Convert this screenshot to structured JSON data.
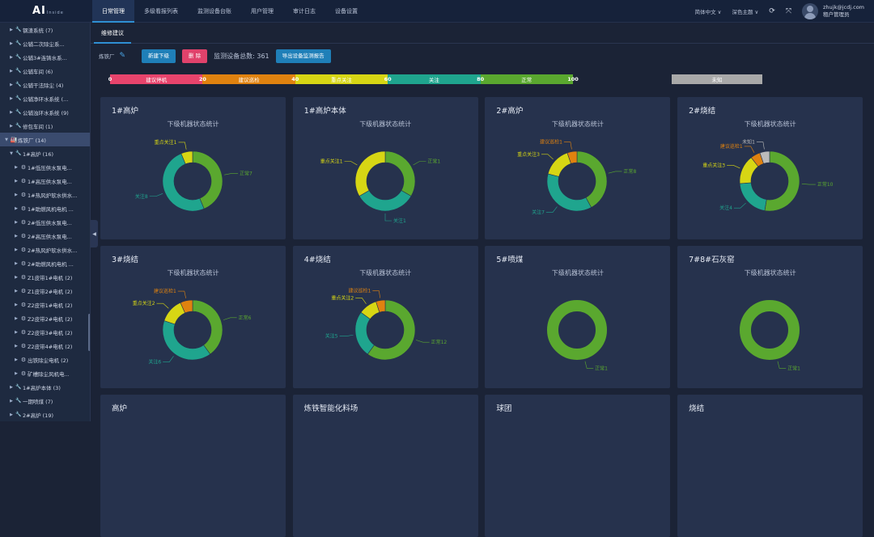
{
  "app": {
    "logo": "AI",
    "logo_small": "Inside"
  },
  "nav": [
    "日常管理",
    "多级看报列表",
    "监测设备台账",
    "用户管理",
    "审计日志",
    "设备设置"
  ],
  "topright": {
    "lang": "简体中文 ∨",
    "theme": "深色主题 ∨",
    "email": "zhujk@jcdj.com",
    "role": "租户管理员"
  },
  "sidebar": [
    {
      "label": "钢渣系统 (7)",
      "icon": "wrench-icon",
      "lvl": 1
    },
    {
      "label": "公辅二次除尘系...",
      "icon": "wrench-icon",
      "lvl": 1
    },
    {
      "label": "公辅3#连铸水系...",
      "icon": "wrench-icon",
      "lvl": 1
    },
    {
      "label": "公辅车间 (6)",
      "icon": "wrench-icon",
      "lvl": 1
    },
    {
      "label": "公辅干法除尘 (4)",
      "icon": "wrench-icon",
      "lvl": 1
    },
    {
      "label": "公辅净环水系统 (...",
      "icon": "wrench-icon",
      "lvl": 1
    },
    {
      "label": "公辅浊环水系统 (9)",
      "icon": "wrench-icon",
      "lvl": 1
    },
    {
      "label": "修包车间 (1)",
      "icon": "wrench-icon",
      "lvl": 1
    },
    {
      "label": "炼铁厂 (14)",
      "icon": "factory-icon",
      "lvl": 0,
      "open": true,
      "sel": true
    },
    {
      "label": "1#高炉 (16)",
      "icon": "wrench-icon",
      "lvl": 1,
      "open": true
    },
    {
      "label": "1#低压供水泵电...",
      "icon": "motor-icon",
      "lvl": 2
    },
    {
      "label": "1#高压供水泵电...",
      "icon": "motor-icon",
      "lvl": 2
    },
    {
      "label": "1#热风炉软水供水...",
      "icon": "motor-icon",
      "lvl": 2
    },
    {
      "label": "1#助燃风机电机 ...",
      "icon": "motor-icon",
      "lvl": 2
    },
    {
      "label": "2#低压供水泵电...",
      "icon": "motor-icon",
      "lvl": 2
    },
    {
      "label": "2#高压供水泵电...",
      "icon": "motor-icon",
      "lvl": 2
    },
    {
      "label": "2#热风炉软水供水...",
      "icon": "motor-icon",
      "lvl": 2
    },
    {
      "label": "2#助燃风机电机 ...",
      "icon": "motor-icon",
      "lvl": 2
    },
    {
      "label": "Z1皮带1#电机 (2)",
      "icon": "motor-icon",
      "lvl": 2
    },
    {
      "label": "Z1皮带2#电机 (2)",
      "icon": "motor-icon",
      "lvl": 2
    },
    {
      "label": "Z2皮带1#电机 (2)",
      "icon": "motor-icon",
      "lvl": 2
    },
    {
      "label": "Z2皮带2#电机 (2)",
      "icon": "motor-icon",
      "lvl": 2
    },
    {
      "label": "Z2皮带3#电机 (2)",
      "icon": "motor-icon",
      "lvl": 2
    },
    {
      "label": "Z2皮带4#电机 (2)",
      "icon": "motor-icon",
      "lvl": 2
    },
    {
      "label": "出铁除尘电机 (2)",
      "icon": "motor-icon",
      "lvl": 2
    },
    {
      "label": "矿槽除尘风机电...",
      "icon": "motor-icon",
      "lvl": 2
    },
    {
      "label": "1#高炉本体 (3)",
      "icon": "wrench-icon",
      "lvl": 1
    },
    {
      "label": "一期喷煤 (7)",
      "icon": "wrench-icon",
      "lvl": 1
    },
    {
      "label": "2#高炉 (19)",
      "icon": "wrench-icon",
      "lvl": 1
    }
  ],
  "tab": "维修建议",
  "toolbar": {
    "factory": "炼铁厂",
    "new_btn": "新建下级",
    "del_btn": "删 除",
    "total": "监测设备总数: 361",
    "export_btn": "导出设备监测报告"
  },
  "legend": {
    "ticks": [
      "0",
      "20",
      "40",
      "60",
      "80",
      "100"
    ],
    "segments": [
      {
        "label": "建议停机",
        "color": "#e8446c"
      },
      {
        "label": "建议巡检",
        "color": "#e0820f"
      },
      {
        "label": "重点关注",
        "color": "#d7d614"
      },
      {
        "label": "关注",
        "color": "#1fa58e"
      },
      {
        "label": "正常",
        "color": "#5aa82f"
      }
    ],
    "unknown": {
      "label": "未知",
      "color": "#a9a9a9"
    }
  },
  "panel_subtitle": "下级机器状态统计",
  "chart_data": [
    {
      "type": "pie",
      "title": "1#高炉",
      "slices": [
        {
          "label": "正常7",
          "value": 7,
          "color": "#5aa82f"
        },
        {
          "label": "关注8",
          "value": 8,
          "color": "#1fa58e"
        },
        {
          "label": "重点关注1",
          "value": 1,
          "color": "#d7d614"
        }
      ]
    },
    {
      "type": "pie",
      "title": "1#高炉本体",
      "slices": [
        {
          "label": "正常1",
          "value": 1,
          "color": "#5aa82f"
        },
        {
          "label": "关注1",
          "value": 1,
          "color": "#1fa58e"
        },
        {
          "label": "重点关注1",
          "value": 1,
          "color": "#d7d614"
        }
      ]
    },
    {
      "type": "pie",
      "title": "2#高炉",
      "slices": [
        {
          "label": "正常8",
          "value": 8,
          "color": "#5aa82f"
        },
        {
          "label": "关注7",
          "value": 7,
          "color": "#1fa58e"
        },
        {
          "label": "重点关注3",
          "value": 3,
          "color": "#d7d614"
        },
        {
          "label": "建议巡检1",
          "value": 1,
          "color": "#e0820f"
        }
      ]
    },
    {
      "type": "pie",
      "title": "2#烧结",
      "slices": [
        {
          "label": "正常10",
          "value": 10,
          "color": "#5aa82f"
        },
        {
          "label": "关注4",
          "value": 4,
          "color": "#1fa58e"
        },
        {
          "label": "重点关注3",
          "value": 3,
          "color": "#d7d614"
        },
        {
          "label": "建议巡检1",
          "value": 1,
          "color": "#e0820f"
        },
        {
          "label": "未知1",
          "value": 1,
          "color": "#bbbbbb"
        }
      ]
    },
    {
      "type": "pie",
      "title": "3#烧结",
      "slices": [
        {
          "label": "正常6",
          "value": 6,
          "color": "#5aa82f"
        },
        {
          "label": "关注6",
          "value": 6,
          "color": "#1fa58e"
        },
        {
          "label": "重点关注2",
          "value": 2,
          "color": "#d7d614"
        },
        {
          "label": "建议巡检1",
          "value": 1,
          "color": "#e0820f"
        }
      ]
    },
    {
      "type": "pie",
      "title": "4#烧结",
      "slices": [
        {
          "label": "正常12",
          "value": 12,
          "color": "#5aa82f"
        },
        {
          "label": "关注5",
          "value": 5,
          "color": "#1fa58e"
        },
        {
          "label": "重点关注2",
          "value": 2,
          "color": "#d7d614"
        },
        {
          "label": "建议巡检1",
          "value": 1,
          "color": "#e0820f"
        }
      ]
    },
    {
      "type": "pie",
      "title": "5#喷煤",
      "slices": [
        {
          "label": "正常1",
          "value": 1,
          "color": "#5aa82f"
        }
      ]
    },
    {
      "type": "pie",
      "title": "7#8#石灰窑",
      "slices": [
        {
          "label": "正常1",
          "value": 1,
          "color": "#5aa82f"
        }
      ]
    },
    {
      "type": "pie",
      "title": "高炉",
      "slices": []
    },
    {
      "type": "pie",
      "title": "炼铁智能化料场",
      "slices": []
    },
    {
      "type": "pie",
      "title": "球团",
      "slices": []
    },
    {
      "type": "pie",
      "title": "烧结",
      "slices": []
    }
  ]
}
